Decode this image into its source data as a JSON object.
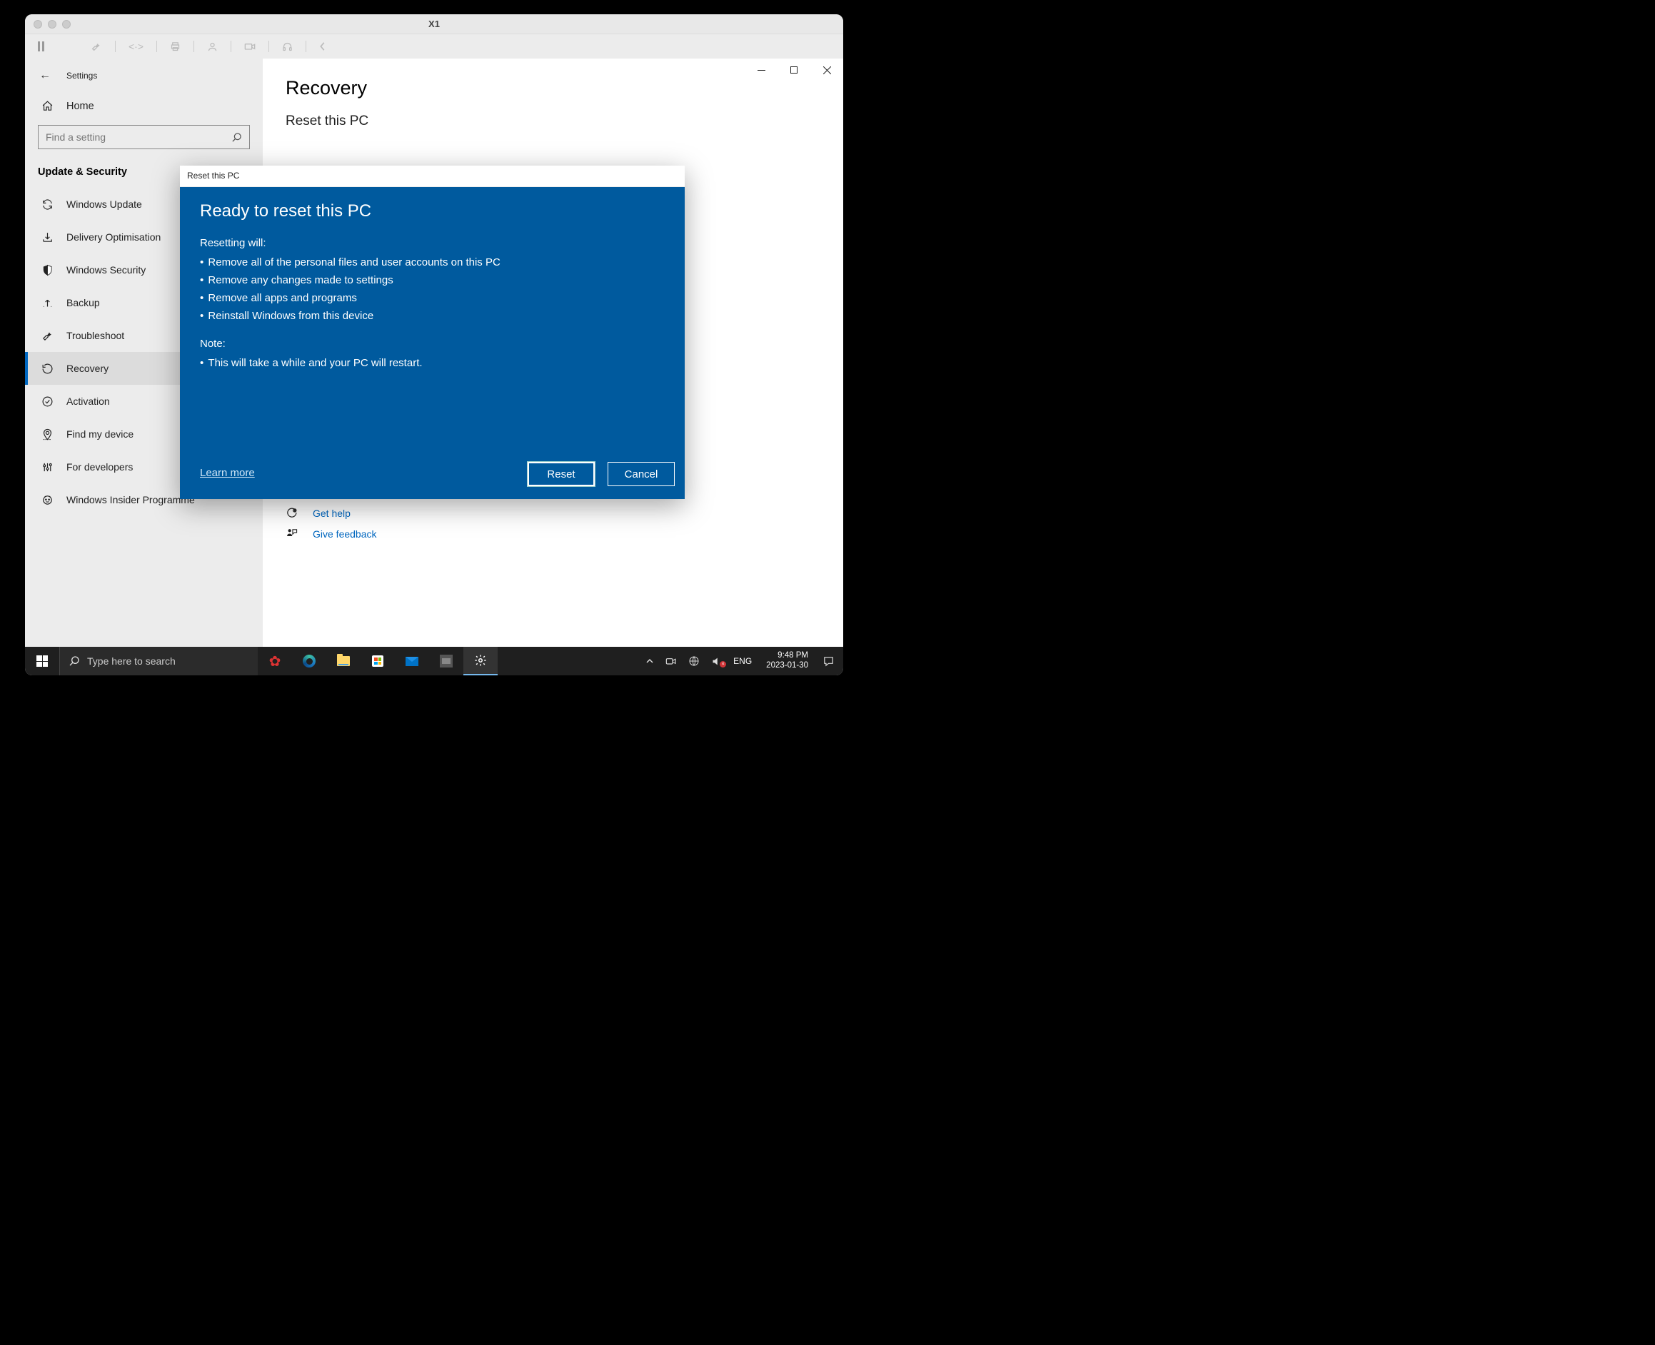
{
  "mac": {
    "title": "X1"
  },
  "settings": {
    "app_title": "Settings",
    "home_label": "Home",
    "search_placeholder": "Find a setting",
    "section_header": "Update & Security",
    "nav": [
      {
        "label": "Windows Update",
        "name": "nav-windows-update",
        "icon": "sync"
      },
      {
        "label": "Delivery Optimisation",
        "name": "nav-delivery-optimisation",
        "icon": "download"
      },
      {
        "label": "Windows Security",
        "name": "nav-windows-security",
        "icon": "shield"
      },
      {
        "label": "Backup",
        "name": "nav-backup",
        "icon": "backup"
      },
      {
        "label": "Troubleshoot",
        "name": "nav-troubleshoot",
        "icon": "wrench"
      },
      {
        "label": "Recovery",
        "name": "nav-recovery",
        "icon": "recovery",
        "selected": true
      },
      {
        "label": "Activation",
        "name": "nav-activation",
        "icon": "check"
      },
      {
        "label": "Find my device",
        "name": "nav-find-my-device",
        "icon": "locate"
      },
      {
        "label": "For developers",
        "name": "nav-for-developers",
        "icon": "sliders"
      },
      {
        "label": "Windows Insider Programme",
        "name": "nav-windows-insider",
        "icon": "insider"
      }
    ],
    "page": {
      "title": "Recovery",
      "subtitle": "Reset this PC",
      "get_help": "Get help",
      "give_feedback": "Give feedback"
    }
  },
  "dialog": {
    "window_title": "Reset this PC",
    "heading": "Ready to reset this PC",
    "resetting_label": "Resetting will:",
    "bullets": [
      "Remove all of the personal files and user accounts on this PC",
      "Remove any changes made to settings",
      "Remove all apps and programs",
      " Reinstall Windows from this device"
    ],
    "note_label": "Note:",
    "notes": [
      " This will take a while and your PC will restart."
    ],
    "learn_more": "Learn more",
    "reset_btn": "Reset",
    "cancel_btn": "Cancel"
  },
  "taskbar": {
    "search_placeholder": "Type here to search",
    "lang": "ENG",
    "time": "9:48 PM",
    "date": "2023-01-30"
  }
}
